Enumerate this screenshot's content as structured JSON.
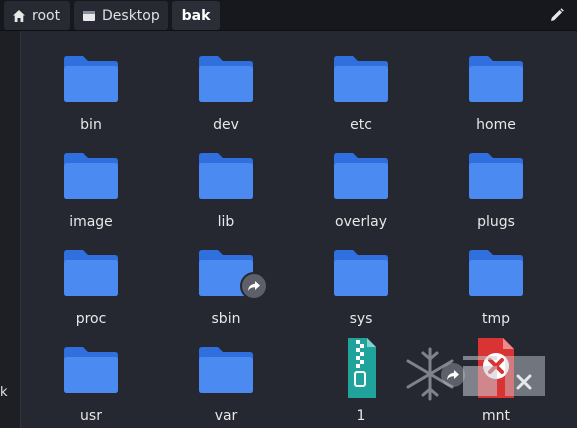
{
  "breadcrumb": [
    {
      "label": "root",
      "icon": "home-icon"
    },
    {
      "label": "Desktop",
      "icon": "desktop-icon"
    },
    {
      "label": "bak"
    }
  ],
  "sidebar": {
    "partial_text": "k"
  },
  "items": [
    {
      "label": "bin",
      "type": "folder"
    },
    {
      "label": "dev",
      "type": "folder"
    },
    {
      "label": "etc",
      "type": "folder"
    },
    {
      "label": "home",
      "type": "folder"
    },
    {
      "label": "image",
      "type": "folder"
    },
    {
      "label": "lib",
      "type": "folder"
    },
    {
      "label": "overlay",
      "type": "folder"
    },
    {
      "label": "plugs",
      "type": "folder"
    },
    {
      "label": "proc",
      "type": "folder"
    },
    {
      "label": "sbin",
      "type": "folder-symlink"
    },
    {
      "label": "sys",
      "type": "folder"
    },
    {
      "label": "tmp",
      "type": "folder"
    },
    {
      "label": "usr",
      "type": "folder"
    },
    {
      "label": "var",
      "type": "folder"
    },
    {
      "label": "1",
      "type": "archive-file"
    },
    {
      "label": "mnt",
      "type": "broken-link"
    }
  ],
  "colors": {
    "background": "#262831",
    "folder": "#2f6fde",
    "folder_light": "#4b8af0",
    "archive": "#1fa39a",
    "broken": "#d93434"
  }
}
